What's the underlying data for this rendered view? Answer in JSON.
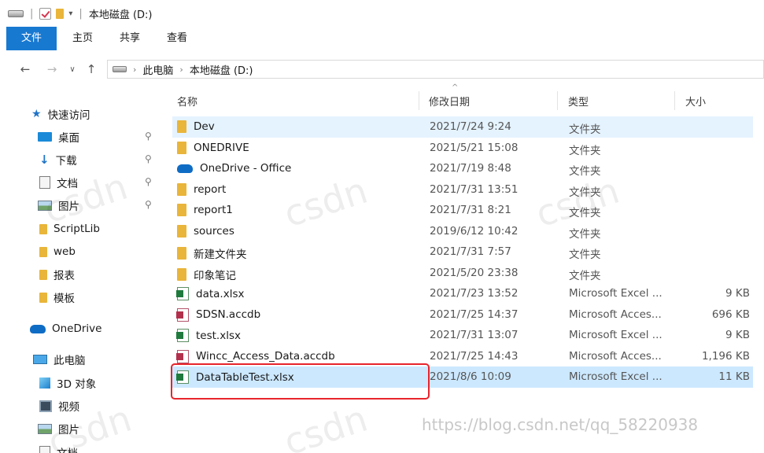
{
  "window": {
    "title": "本地磁盘 (D:)"
  },
  "ribbon": {
    "tabs": [
      "文件",
      "主页",
      "共享",
      "查看"
    ]
  },
  "address": {
    "crumbs": [
      "此电脑",
      "本地磁盘 (D:)"
    ]
  },
  "sidebar": {
    "quick_access": "快速访问",
    "items": [
      {
        "label": "桌面",
        "pinned": true
      },
      {
        "label": "下载",
        "pinned": true
      },
      {
        "label": "文档",
        "pinned": true
      },
      {
        "label": "图片",
        "pinned": true
      },
      {
        "label": "ScriptLib",
        "pinned": false
      },
      {
        "label": "web",
        "pinned": false
      },
      {
        "label": "报表",
        "pinned": false
      },
      {
        "label": "模板",
        "pinned": false
      }
    ],
    "onedrive": "OneDrive",
    "this_pc": "此电脑",
    "pc_items": [
      "3D 对象",
      "视频",
      "图片",
      "文档"
    ]
  },
  "columns": {
    "name": "名称",
    "date": "修改日期",
    "type": "类型",
    "size": "大小"
  },
  "files": [
    {
      "name": "Dev",
      "date": "2021/7/24 9:24",
      "type": "文件夹",
      "size": "",
      "icon": "folder",
      "state": "hover"
    },
    {
      "name": "ONEDRIVE",
      "date": "2021/5/21 15:08",
      "type": "文件夹",
      "size": "",
      "icon": "folder",
      "state": ""
    },
    {
      "name": "OneDrive - Office",
      "date": "2021/7/19 8:48",
      "type": "文件夹",
      "size": "",
      "icon": "cloud",
      "state": ""
    },
    {
      "name": "report",
      "date": "2021/7/31 13:51",
      "type": "文件夹",
      "size": "",
      "icon": "folder",
      "state": ""
    },
    {
      "name": "report1",
      "date": "2021/7/31 8:21",
      "type": "文件夹",
      "size": "",
      "icon": "folder",
      "state": ""
    },
    {
      "name": "sources",
      "date": "2019/6/12 10:42",
      "type": "文件夹",
      "size": "",
      "icon": "folder",
      "state": ""
    },
    {
      "name": "新建文件夹",
      "date": "2021/7/31 7:57",
      "type": "文件夹",
      "size": "",
      "icon": "folder",
      "state": ""
    },
    {
      "name": "印象笔记",
      "date": "2021/5/20 23:38",
      "type": "文件夹",
      "size": "",
      "icon": "folder",
      "state": ""
    },
    {
      "name": "data.xlsx",
      "date": "2021/7/23 13:52",
      "type": "Microsoft Excel ...",
      "size": "9 KB",
      "icon": "excel",
      "state": ""
    },
    {
      "name": "SDSN.accdb",
      "date": "2021/7/25 14:37",
      "type": "Microsoft Acces...",
      "size": "696 KB",
      "icon": "access",
      "state": ""
    },
    {
      "name": "test.xlsx",
      "date": "2021/7/31 13:07",
      "type": "Microsoft Excel ...",
      "size": "9 KB",
      "icon": "excel",
      "state": ""
    },
    {
      "name": "Wincc_Access_Data.accdb",
      "date": "2021/7/25 14:43",
      "type": "Microsoft Acces...",
      "size": "1,196 KB",
      "icon": "access",
      "state": ""
    },
    {
      "name": "DataTableTest.xlsx",
      "date": "2021/8/6 10:09",
      "type": "Microsoft Excel ...",
      "size": "11 KB",
      "icon": "excel",
      "state": "selected"
    }
  ],
  "watermarks": {
    "csdn": "csdn",
    "footer": "https://blog.csdn.net/qq_58220938"
  },
  "colors": {
    "accent": "#1879d1",
    "selection": "#cce8ff",
    "highlight": "#e8242c",
    "folder": "#e9b53a"
  }
}
